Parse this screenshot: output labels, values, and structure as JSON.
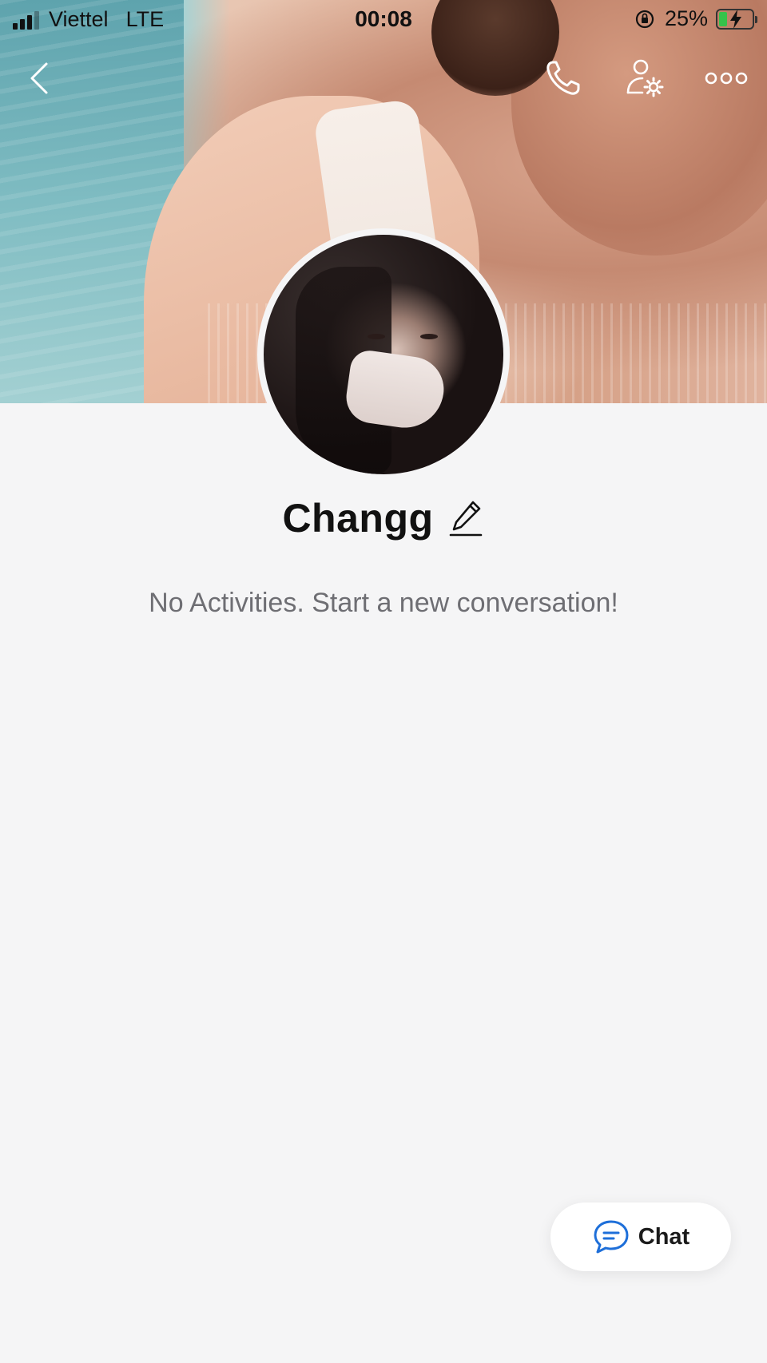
{
  "status_bar": {
    "carrier": "Viettel",
    "network": "LTE",
    "time": "00:08",
    "battery_percent": "25%",
    "battery_level": 0.25,
    "charging": true
  },
  "header": {
    "icons": [
      "back-chevron-icon",
      "phone-icon",
      "profile-settings-icon",
      "more-dots-icon"
    ]
  },
  "profile": {
    "name": "Changg",
    "edit_icon": "pencil-icon"
  },
  "activity": {
    "empty_message": "No Activities. Start a new conversation!"
  },
  "chat_button": {
    "label": "Chat",
    "icon": "chat-bubble-icon",
    "accent_color": "#1e6fd9"
  }
}
